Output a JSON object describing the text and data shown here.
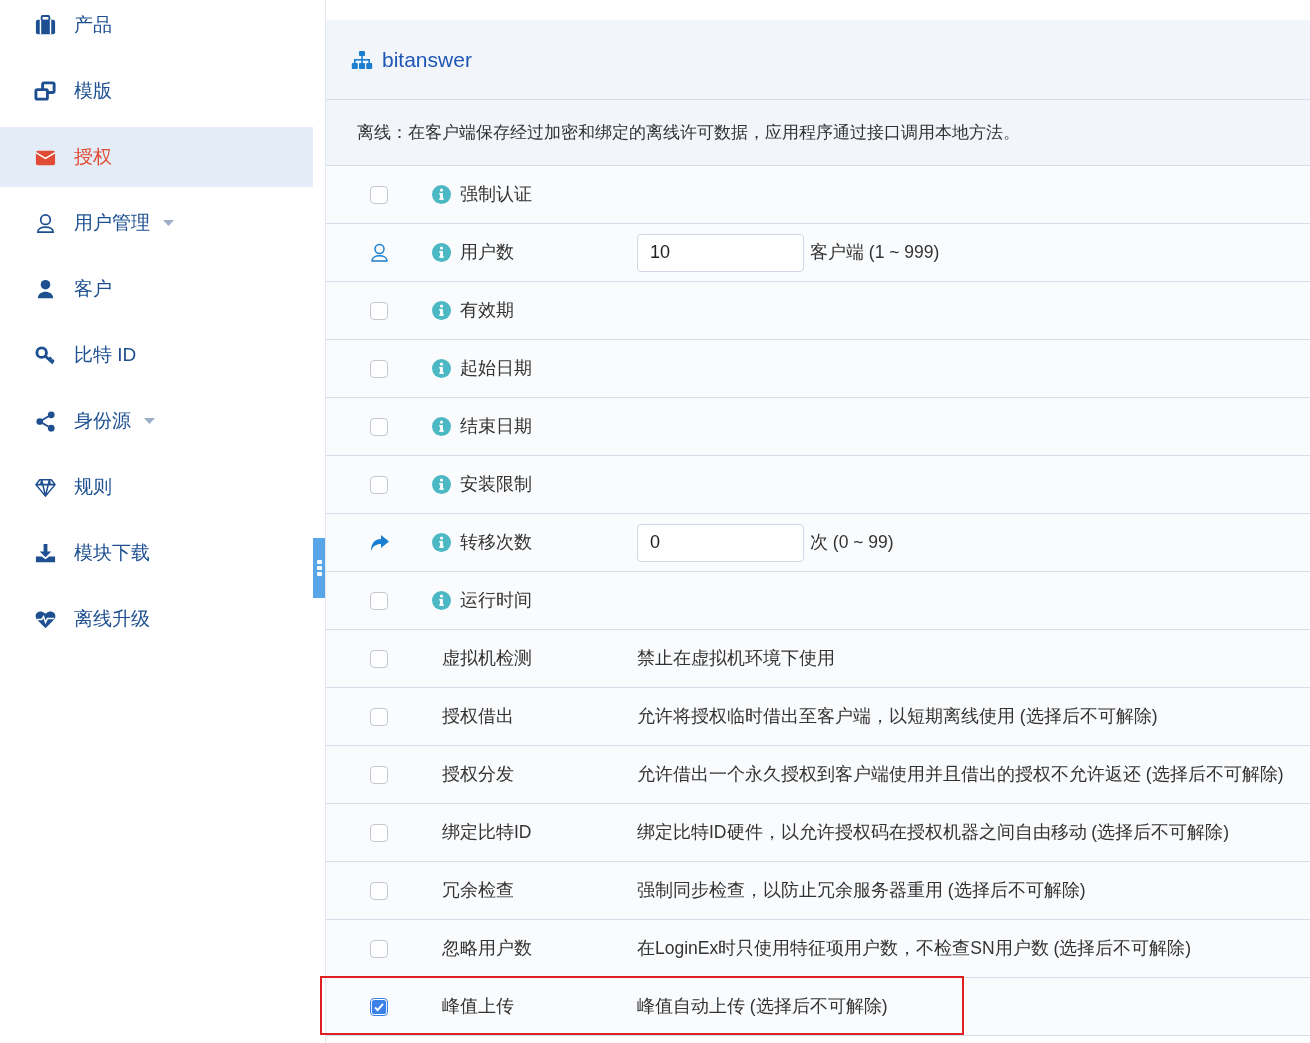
{
  "sidebar": {
    "items": [
      {
        "label": "产品",
        "selected": false,
        "dropdown": false
      },
      {
        "label": "模版",
        "selected": false,
        "dropdown": false
      },
      {
        "label": "授权",
        "selected": true,
        "dropdown": false
      },
      {
        "label": "用户管理",
        "selected": false,
        "dropdown": true
      },
      {
        "label": "客户",
        "selected": false,
        "dropdown": false
      },
      {
        "label": "比特 ID",
        "selected": false,
        "dropdown": false
      },
      {
        "label": "身份源",
        "selected": false,
        "dropdown": true
      },
      {
        "label": "规则",
        "selected": false,
        "dropdown": false
      },
      {
        "label": "模块下载",
        "selected": false,
        "dropdown": false
      },
      {
        "label": "离线升级",
        "selected": false,
        "dropdown": false
      }
    ]
  },
  "panel": {
    "title": "bitanswer",
    "description": "离线：在客户端保存经过加密和绑定的离线许可数据，应用程序通过接口调用本地方法。",
    "rows": [
      {
        "kind": "toggle",
        "label": "强制认证",
        "checked": false
      },
      {
        "kind": "input",
        "label": "用户数",
        "value": "10",
        "unit": "客户端 (1 ~ 999)"
      },
      {
        "kind": "toggle",
        "label": "有效期",
        "checked": false
      },
      {
        "kind": "toggle",
        "label": "起始日期",
        "checked": false
      },
      {
        "kind": "toggle",
        "label": "结束日期",
        "checked": false
      },
      {
        "kind": "toggle",
        "label": "安装限制",
        "checked": false
      },
      {
        "kind": "input",
        "label": "转移次数",
        "value": "0",
        "unit": "次 (0 ~ 99)"
      },
      {
        "kind": "toggle",
        "label": "运行时间",
        "checked": false
      },
      {
        "kind": "feature",
        "label": "虚拟机检测",
        "description": "禁止在虚拟机环境下使用",
        "checked": false,
        "highlighted": false
      },
      {
        "kind": "feature",
        "label": "授权借出",
        "description": "允许将授权临时借出至客户端，以短期离线使用 (选择后不可解除)",
        "checked": false,
        "highlighted": false
      },
      {
        "kind": "feature",
        "label": "授权分发",
        "description": "允许借出一个永久授权到客户端使用并且借出的授权不允许返还 (选择后不可解除)",
        "checked": false,
        "highlighted": false
      },
      {
        "kind": "feature",
        "label": "绑定比特ID",
        "description": "绑定比特ID硬件，以允许授权码在授权机器之间自由移动 (选择后不可解除)",
        "checked": false,
        "highlighted": false
      },
      {
        "kind": "feature",
        "label": "冗余检查",
        "description": "强制同步检查，以防止冗余服务器重用 (选择后不可解除)",
        "checked": false,
        "highlighted": false
      },
      {
        "kind": "feature",
        "label": "忽略用户数",
        "description": "在LoginEx时只使用特征项用户数，不检查SN用户数 (选择后不可解除)",
        "checked": false,
        "highlighted": false
      },
      {
        "kind": "feature",
        "label": "峰值上传",
        "description": "峰值自动上传 (选择后不可解除)",
        "checked": true,
        "highlighted": true
      }
    ]
  }
}
